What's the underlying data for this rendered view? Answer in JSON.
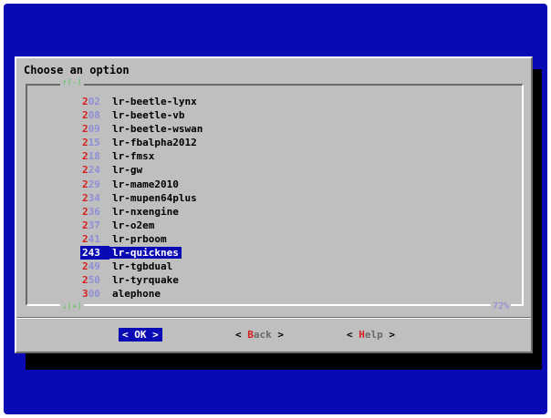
{
  "dialog": {
    "title": "Choose an option",
    "scroll_up": "↑(-)",
    "scroll_down": "↓(+)",
    "percent": "72%"
  },
  "items": [
    {
      "tag_hot": "2",
      "tag_rest": "02",
      "label": "lr-beetle-lynx",
      "selected": false
    },
    {
      "tag_hot": "2",
      "tag_rest": "08",
      "label": "lr-beetle-vb",
      "selected": false
    },
    {
      "tag_hot": "2",
      "tag_rest": "09",
      "label": "lr-beetle-wswan",
      "selected": false
    },
    {
      "tag_hot": "2",
      "tag_rest": "15",
      "label": "lr-fbalpha2012",
      "selected": false
    },
    {
      "tag_hot": "2",
      "tag_rest": "18",
      "label": "lr-fmsx",
      "selected": false
    },
    {
      "tag_hot": "2",
      "tag_rest": "24",
      "label": "lr-gw",
      "selected": false
    },
    {
      "tag_hot": "2",
      "tag_rest": "29",
      "label": "lr-mame2010",
      "selected": false
    },
    {
      "tag_hot": "2",
      "tag_rest": "34",
      "label": "lr-mupen64plus",
      "selected": false
    },
    {
      "tag_hot": "2",
      "tag_rest": "36",
      "label": "lr-nxengine",
      "selected": false
    },
    {
      "tag_hot": "2",
      "tag_rest": "37",
      "label": "lr-o2em",
      "selected": false
    },
    {
      "tag_hot": "2",
      "tag_rest": "41",
      "label": "lr-prboom",
      "selected": false
    },
    {
      "tag_hot": "2",
      "tag_rest": "43",
      "label": "lr-quicknes",
      "selected": true
    },
    {
      "tag_hot": "2",
      "tag_rest": "49",
      "label": "lr-tgbdual",
      "selected": false
    },
    {
      "tag_hot": "2",
      "tag_rest": "50",
      "label": "lr-tyrquake",
      "selected": false
    },
    {
      "tag_hot": "3",
      "tag_rest": "00",
      "label": "alephone",
      "selected": false
    }
  ],
  "buttons": {
    "ok": {
      "left": "<",
      "hot": "",
      "rest": " OK ",
      "right": ">"
    },
    "back": {
      "left": "<",
      "hot": "B",
      "rest": "ack",
      "right": ">"
    },
    "help": {
      "left": "<",
      "hot": "H",
      "rest": "elp",
      "right": ">"
    }
  },
  "colors": {
    "background": "#0a0ab4",
    "dialog": "#bfbfbf",
    "hotkey": "#d42020",
    "selection": "#0a0ab4"
  }
}
